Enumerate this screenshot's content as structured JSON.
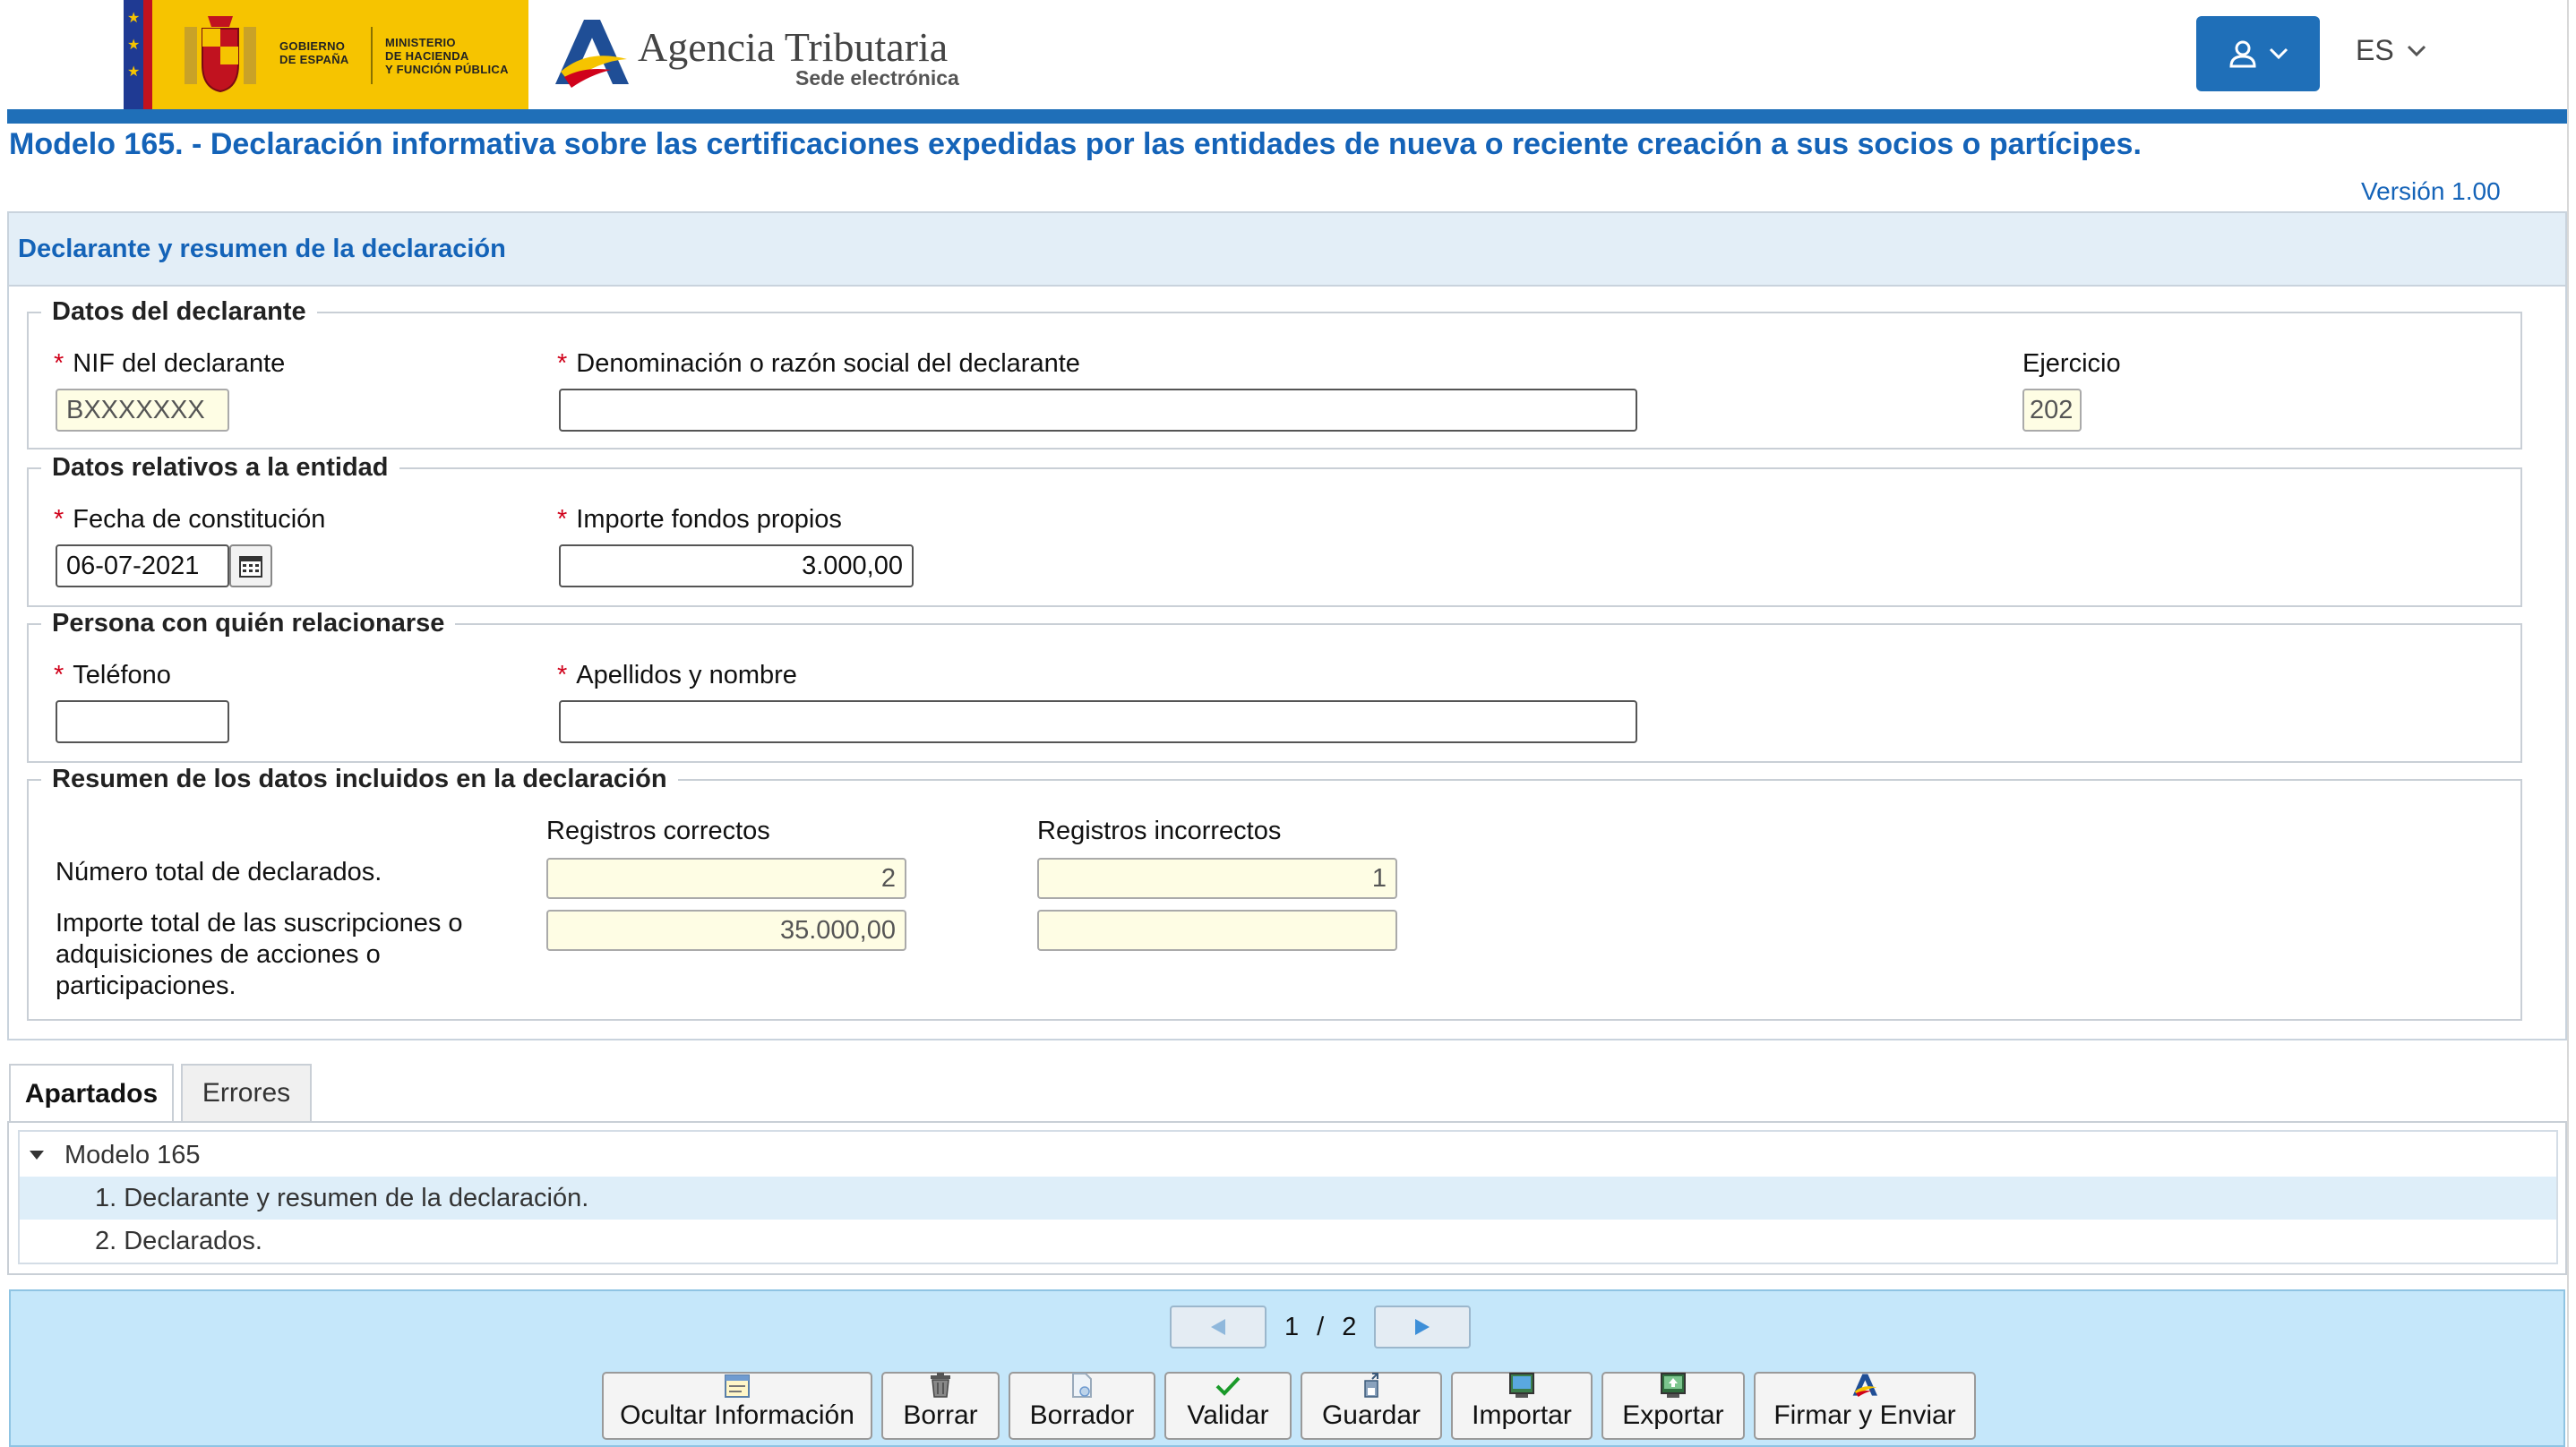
{
  "header": {
    "gov_line1": "GOBIERNO",
    "gov_line2": "DE ESPAÑA",
    "ministry_line1": "MINISTERIO",
    "ministry_line2": "DE HACIENDA",
    "ministry_line3": "Y FUNCIÓN PÚBLICA",
    "agency_name": "Agencia Tributaria",
    "agency_sub": "Sede electrónica",
    "language": "ES",
    "icons": [
      "user-icon",
      "chevron-down-icon"
    ]
  },
  "page": {
    "title": "Modelo 165. - Declaración informativa sobre las certificaciones expedidas por las entidades de nueva o reciente creación a sus socios o partícipes.",
    "version": "Versión 1.00"
  },
  "panel": {
    "title": "Declarante y resumen de la declaración",
    "required_mark": "*",
    "declarante": {
      "legend": "Datos del declarante",
      "nif_label": "NIF del declarante",
      "nif_value": "BXXXXXXX",
      "name_label": "Denominación o razón social del declarante",
      "name_value": "",
      "ejercicio_label": "Ejercicio",
      "ejercicio_value": "202"
    },
    "entidad": {
      "legend": "Datos relativos a la entidad",
      "fecha_label": "Fecha de constitución",
      "fecha_value": "06-07-2021",
      "importe_label": "Importe fondos propios",
      "importe_value": "3.000,00"
    },
    "persona": {
      "legend": "Persona con quién relacionarse",
      "telefono_label": "Teléfono",
      "telefono_value": "",
      "nombre_label": "Apellidos y nombre",
      "nombre_value": ""
    },
    "resumen": {
      "legend": "Resumen de los datos incluidos en la declaración",
      "col_correctos": "Registros correctos",
      "col_incorrectos": "Registros incorrectos",
      "row1_label": "Número total de declarados.",
      "row1_correctos": "2",
      "row1_incorrectos": "1",
      "row2_label_line1": "Importe total de las suscripciones o",
      "row2_label_line2": "adquisiciones de acciones o",
      "row2_label_line3": "participaciones.",
      "row2_correctos": "35.000,00",
      "row2_incorrectos": ""
    }
  },
  "tabs": [
    {
      "label": "Apartados",
      "active": true
    },
    {
      "label": "Errores",
      "active": false
    }
  ],
  "tree": {
    "root": "Modelo 165",
    "items": [
      {
        "label": "1. Declarante y resumen de la declaración.",
        "selected": true
      },
      {
        "label": "2. Declarados.",
        "selected": false
      }
    ]
  },
  "pager": {
    "current": "1",
    "separator": "/",
    "total": "2"
  },
  "toolbar": {
    "buttons": [
      {
        "label": "Ocultar Información",
        "icon": "info-panel-icon"
      },
      {
        "label": "Borrar",
        "icon": "trash-icon"
      },
      {
        "label": "Borrador",
        "icon": "draft-document-icon"
      },
      {
        "label": "Validar",
        "icon": "check-icon"
      },
      {
        "label": "Guardar",
        "icon": "save-icon"
      },
      {
        "label": "Importar",
        "icon": "import-icon"
      },
      {
        "label": "Exportar",
        "icon": "export-icon"
      },
      {
        "label": "Firmar y Enviar",
        "icon": "sign-send-icon"
      }
    ]
  },
  "colors": {
    "brand_blue": "#1f6fb8",
    "title_blue": "#1463b8",
    "gov_yellow": "#f6c400",
    "required_red": "#d0021b",
    "toolbar_bg": "#c5e7fa",
    "readonly_bg": "#fefde4"
  }
}
